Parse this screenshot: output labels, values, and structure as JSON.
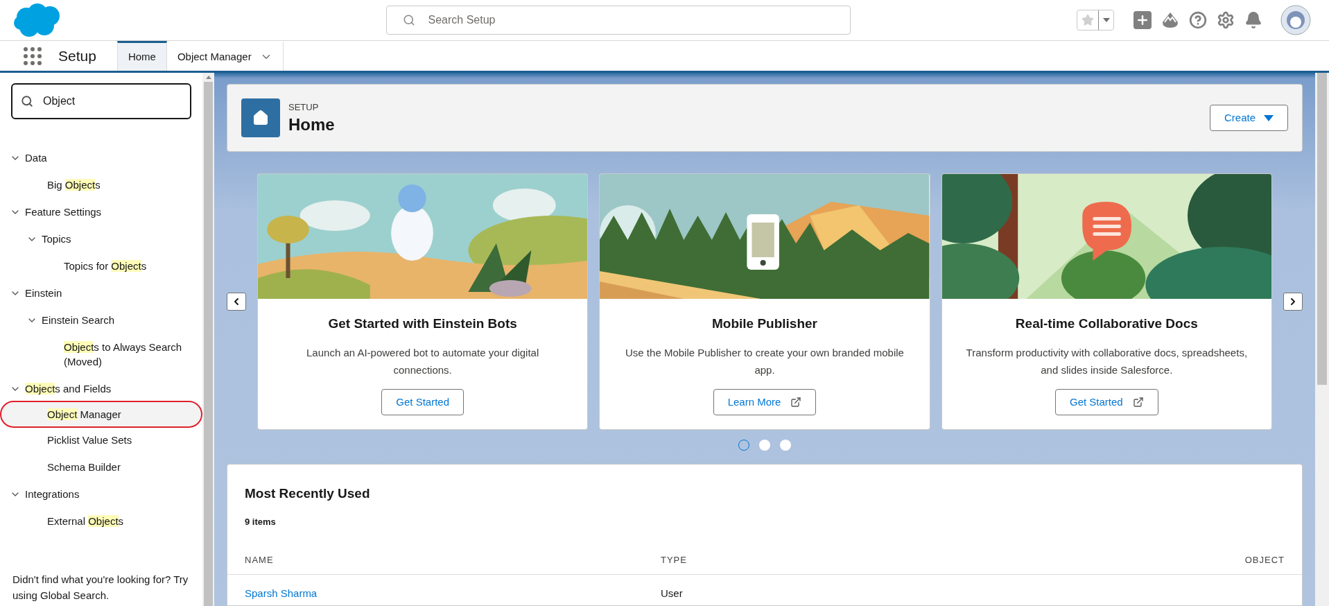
{
  "header": {
    "search": {
      "placeholder": "Search Setup"
    }
  },
  "nav": {
    "app_name": "Setup",
    "tabs": [
      {
        "label": "Home",
        "selected": true,
        "has_menu": false
      },
      {
        "label": "Object Manager",
        "selected": false,
        "has_menu": true
      }
    ]
  },
  "sidebar": {
    "search": {
      "value": "Object"
    },
    "tree": [
      {
        "parts": [
          {
            "text": "Data",
            "highlighted": false
          }
        ],
        "expanded": true,
        "selected": false,
        "circled": false,
        "children": [
          {
            "parts": [
              {
                "text": "Big ",
                "highlighted": false
              },
              {
                "text": "Object",
                "highlighted": true
              },
              {
                "text": "s",
                "highlighted": false
              }
            ],
            "selected": false,
            "circled": false
          }
        ]
      },
      {
        "parts": [
          {
            "text": "Feature Settings",
            "highlighted": false
          }
        ],
        "expanded": true,
        "selected": false,
        "circled": false,
        "children": [
          {
            "parts": [
              {
                "text": "Topics",
                "highlighted": false
              }
            ],
            "expanded": true,
            "selected": false,
            "circled": false,
            "children": [
              {
                "parts": [
                  {
                    "text": "Topics for ",
                    "highlighted": false
                  },
                  {
                    "text": "Object",
                    "highlighted": true
                  },
                  {
                    "text": "s",
                    "highlighted": false
                  }
                ],
                "selected": false,
                "circled": false
              }
            ]
          }
        ]
      },
      {
        "parts": [
          {
            "text": "Einstein",
            "highlighted": false
          }
        ],
        "expanded": true,
        "selected": false,
        "circled": false,
        "children": [
          {
            "parts": [
              {
                "text": "Einstein Search",
                "highlighted": false
              }
            ],
            "expanded": true,
            "selected": false,
            "circled": false,
            "children": [
              {
                "parts": [
                  {
                    "text": "Object",
                    "highlighted": true
                  },
                  {
                    "text": "s to Always Search (Moved)",
                    "highlighted": false
                  }
                ],
                "selected": false,
                "circled": false
              }
            ]
          }
        ]
      },
      {
        "parts": [
          {
            "text": "Object",
            "highlighted": true
          },
          {
            "text": "s and Fields",
            "highlighted": false
          }
        ],
        "expanded": true,
        "selected": false,
        "circled": false,
        "children": [
          {
            "parts": [
              {
                "text": "Object",
                "highlighted": true
              },
              {
                "text": " Manager",
                "highlighted": false
              }
            ],
            "selected": true,
            "circled": true
          },
          {
            "parts": [
              {
                "text": "Picklist Value Sets",
                "highlighted": false
              }
            ],
            "selected": false,
            "circled": false
          },
          {
            "parts": [
              {
                "text": "Schema Builder",
                "highlighted": false
              }
            ],
            "selected": false,
            "circled": false
          }
        ]
      },
      {
        "parts": [
          {
            "text": "Integrations",
            "highlighted": false
          }
        ],
        "expanded": true,
        "selected": false,
        "circled": false,
        "children": [
          {
            "parts": [
              {
                "text": "External ",
                "highlighted": false
              },
              {
                "text": "Object",
                "highlighted": true
              },
              {
                "text": "s",
                "highlighted": false
              }
            ],
            "selected": false,
            "circled": false
          }
        ]
      }
    ],
    "footer": "Didn't find what you're looking for? Try using Global Search."
  },
  "page_header": {
    "eyebrow": "SETUP",
    "title": "Home",
    "create_button": "Create"
  },
  "carousel": {
    "cards": [
      {
        "title": "Get Started with Einstein Bots",
        "description": "Launch an AI-powered bot to automate your digital connections.",
        "button": "Get Started",
        "external": false
      },
      {
        "title": "Mobile Publisher",
        "description": "Use the Mobile Publisher to create your own branded mobile app.",
        "button": "Learn More",
        "external": true
      },
      {
        "title": "Real-time Collaborative Docs",
        "description": "Transform productivity with collaborative docs, spreadsheets, and slides inside Salesforce.",
        "button": "Get Started",
        "external": true
      }
    ],
    "dots": [
      {
        "selected": true
      },
      {
        "selected": false
      },
      {
        "selected": false
      }
    ]
  },
  "recent": {
    "title": "Most Recently Used",
    "count": "9 items",
    "columns": [
      "NAME",
      "TYPE",
      "OBJECT"
    ],
    "rows": [
      {
        "name": "Sparsh Sharma",
        "type": "User"
      }
    ]
  }
}
